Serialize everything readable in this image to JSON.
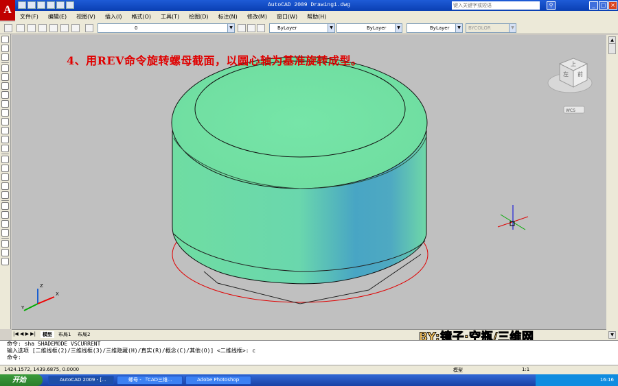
{
  "app": {
    "title": "AutoCAD 2009 Drawing1.dwg",
    "logo_letter": "A",
    "search_placeholder": "键入关键字或短语"
  },
  "menu": [
    "文件(F)",
    "编辑(E)",
    "视图(V)",
    "插入(I)",
    "格式(O)",
    "工具(T)",
    "绘图(D)",
    "标注(N)",
    "修改(M)",
    "窗口(W)",
    "帮助(H)"
  ],
  "toolbar": {
    "layer_value": "0",
    "color_value": "ByLayer",
    "linetype_value": "ByLayer",
    "lineweight_value": "ByLayer",
    "plotstyle_value": "BYCOLOR"
  },
  "canvas": {
    "caption": "4、用REV命令旋转螺母截面，以圆心轴为基准旋转成型。",
    "viewcube_top": "上",
    "viewcube_left": "左",
    "viewcube_front": "前",
    "wcs_label": "WCS",
    "ucs_x": "X",
    "ucs_y": "Y",
    "ucs_z": "Z",
    "object_color_top": "#78e6a8",
    "object_color_side": "#4aa6c8",
    "section_color": "#e00000"
  },
  "layout_tabs": [
    "模型",
    "布局1",
    "布局2"
  ],
  "command": {
    "line1": "命令: sha SHADEMODE VSCURRENT",
    "line2": "输入选项 [二维线框(2)/三维线框(3)/三维隐藏(H)/真实(R)/概念(C)/其他(O)] <二维线框>: c",
    "line3": "命令:"
  },
  "status": {
    "coords": "1424.1572, 1439.6875, 0.0000",
    "model_label": "模型",
    "scale_label": "1:1"
  },
  "watermark": "BY:镜子·空瓶/三维网",
  "taskbar": {
    "start_label": "开始",
    "tasks": [
      "AutoCAD 2009 - [...",
      "螺母 - 『CAD三维...",
      "Adobe Photoshop"
    ],
    "clock": "16:16"
  }
}
